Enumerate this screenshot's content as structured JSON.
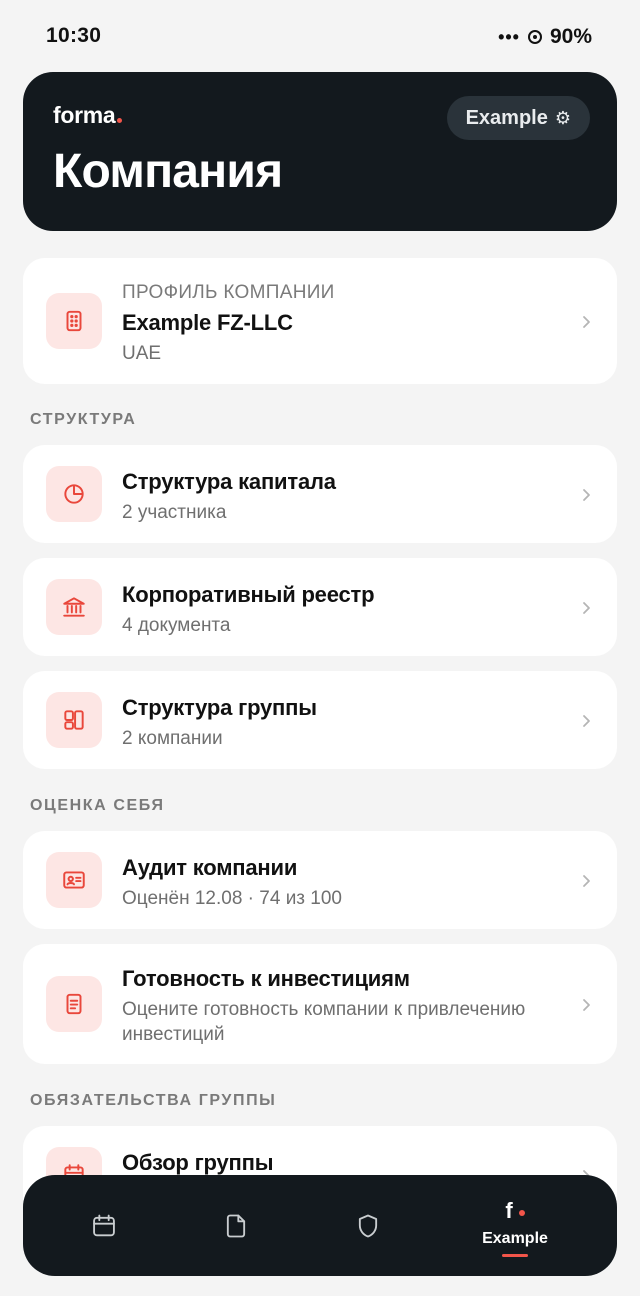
{
  "status_bar": {
    "time": "10:30",
    "signal": "•••",
    "battery": "90%"
  },
  "header": {
    "brand": "forma",
    "title": "Компания",
    "workspace_label": "Example",
    "workspace_icon": "gear-icon"
  },
  "profile_card": {
    "eyebrow": "ПРОФИЛЬ КОМПАНИИ",
    "title": "Example FZ-LLC",
    "subtitle": "UAE",
    "icon": "building-icon"
  },
  "sections": {
    "structure": {
      "label": "СТРУКТУРА",
      "items": [
        {
          "title": "Структура капитала",
          "subtitle": "2 участника",
          "icon": "pie-chart-icon"
        },
        {
          "title": "Корпоративный реестр",
          "subtitle": "4 документа",
          "icon": "bank-icon"
        },
        {
          "title": "Структура группы",
          "subtitle": "2 компании",
          "icon": "layout-icon"
        }
      ]
    },
    "self_assessment": {
      "label": "ОЦЕНКА СЕБЯ",
      "items": [
        {
          "title": "Аудит компании",
          "subtitle": "Оценён 12.08 · 74 из 100",
          "icon": "id-card-icon"
        },
        {
          "title": "Готовность к инвестициям",
          "subtitle": "Оцените готовность компании к привлечению инвестиций",
          "icon": "document-icon"
        }
      ]
    },
    "group_obligations": {
      "label": "ОБЯЗАТЕЛЬСТВА ГРУППЫ",
      "items": [
        {
          "title": "Обзор группы",
          "icon": "calendar-icon"
        }
      ]
    }
  },
  "tab_bar": {
    "tabs": [
      {
        "name": "calendar",
        "icon": "calendar-icon"
      },
      {
        "name": "documents",
        "icon": "file-icon"
      },
      {
        "name": "security",
        "icon": "shield-icon"
      },
      {
        "name": "company",
        "logo": "f",
        "label": "Example",
        "active": true
      }
    ]
  },
  "colors": {
    "accent": "#f2554a",
    "dark": "#13191e",
    "icon_bg": "#fde6e4",
    "background": "#f4f4f4"
  }
}
